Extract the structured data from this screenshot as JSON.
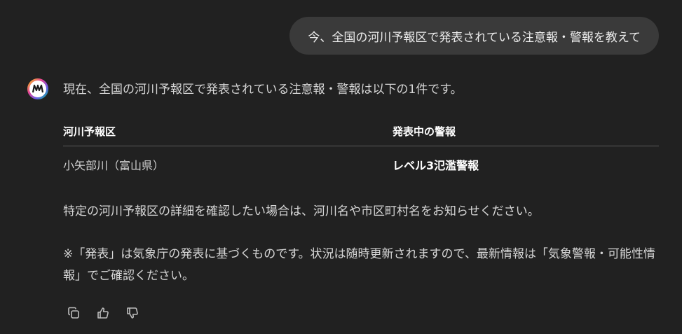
{
  "user_message": "今、全国の河川予報区で発表されている注意報・警報を教えて",
  "assistant": {
    "intro": "現在、全国の河川予報区で発表されている注意報・警報は以下の1件です。",
    "table": {
      "headers": [
        "河川予報区",
        "発表中の警報"
      ],
      "rows": [
        [
          "小矢部川（富山県）",
          "レベル3氾濫警報"
        ]
      ]
    },
    "paragraph_1": "特定の河川予報区の詳細を確認したい場合は、河川名や市区町村名をお知らせください。",
    "paragraph_2": "※「発表」は気象庁の発表に基づくものです。状況は随時更新されますので、最新情報は「気象警報・可能性情報」でご確認ください。"
  },
  "actions": {
    "copy_icon": "copy-icon",
    "thumbs_up_icon": "thumbs-up-icon",
    "thumbs_down_icon": "thumbs-down-icon"
  },
  "colors": {
    "background": "#212121",
    "user_bubble": "#3a3a3a",
    "text": "#d6d6d6",
    "divider": "#5a5a5a"
  }
}
